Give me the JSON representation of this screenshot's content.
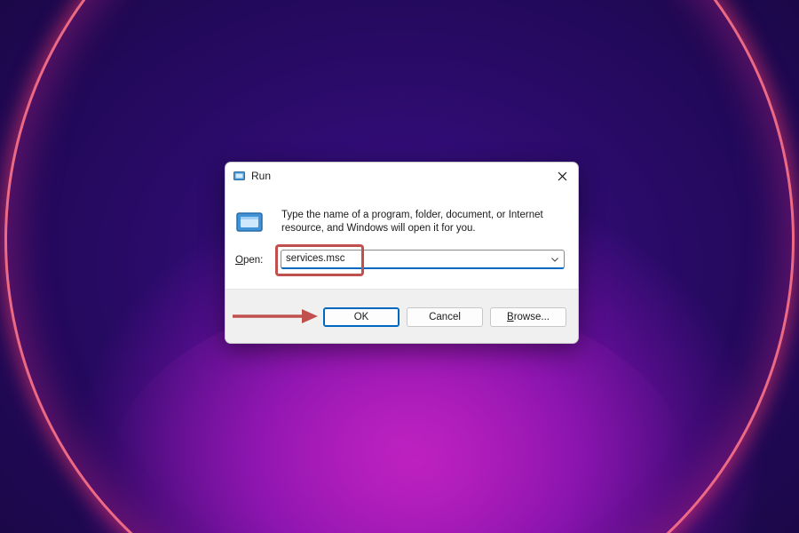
{
  "dialog": {
    "title": "Run",
    "description": "Type the name of a program, folder, document, or Internet resource, and Windows will open it for you.",
    "open_label_access_key": "O",
    "open_label_rest": "pen:",
    "input_value": "services.msc",
    "buttons": {
      "ok": "OK",
      "cancel": "Cancel",
      "browse_access_key": "B",
      "browse_rest": "rowse..."
    }
  },
  "icons": {
    "title": "run-icon",
    "main": "run-icon",
    "close": "close-icon",
    "dropdown": "chevron-down-icon",
    "annotation": "arrow-right-icon"
  },
  "colors": {
    "accent": "#0067c0",
    "annotation": "#c0504d",
    "dialog_background": "#ffffff",
    "footer_background": "#f0f0f0"
  }
}
